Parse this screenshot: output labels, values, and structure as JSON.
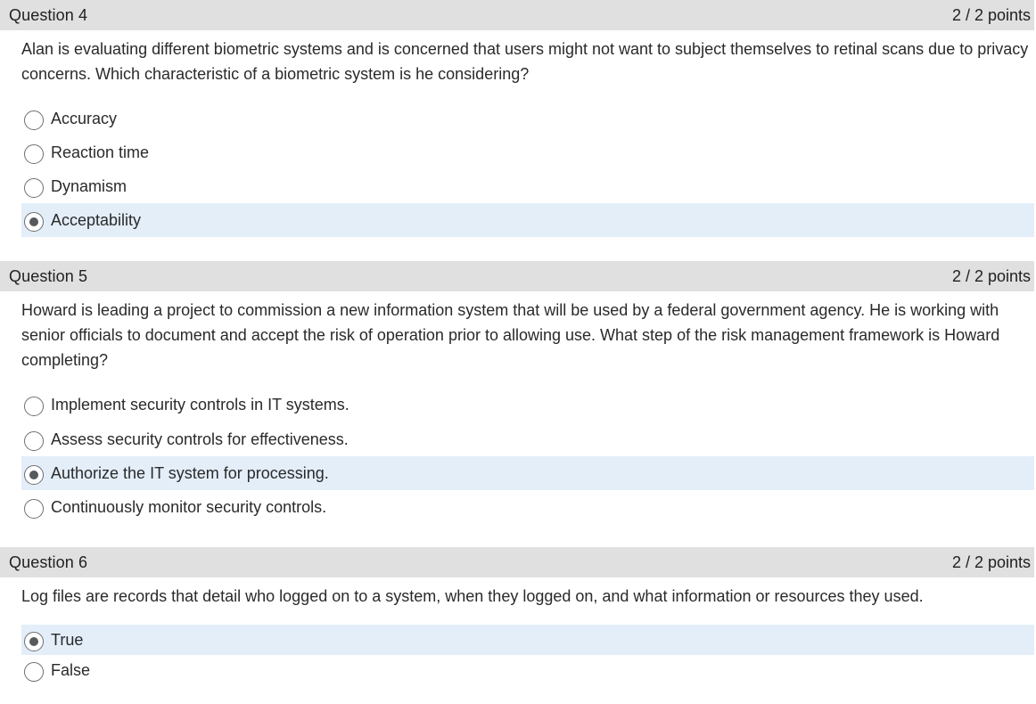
{
  "questions": [
    {
      "title": "Question 4",
      "points": "2 / 2 points",
      "text": "Alan is evaluating different biometric systems and is concerned that users might not want to subject themselves to retinal scans due to privacy concerns. Which characteristic of a biometric system is he considering?",
      "options": [
        {
          "label": "Accuracy",
          "selected": false
        },
        {
          "label": "Reaction time",
          "selected": false
        },
        {
          "label": "Dynamism",
          "selected": false
        },
        {
          "label": "Acceptability",
          "selected": true
        }
      ]
    },
    {
      "title": "Question 5",
      "points": "2 / 2 points",
      "text": "Howard is leading a project to commission a new information system that will be used by a federal government agency. He is working with senior officials to document and accept the risk of operation prior to allowing use. What step of the risk management framework is Howard completing?",
      "options": [
        {
          "label": "Implement security controls in IT systems.",
          "selected": false
        },
        {
          "label": "Assess security controls for effectiveness.",
          "selected": false
        },
        {
          "label": "Authorize the IT system for processing.",
          "selected": true
        },
        {
          "label": "Continuously monitor security controls.",
          "selected": false
        }
      ]
    },
    {
      "title": "Question 6",
      "points": "2 / 2 points",
      "text": "Log files are records that detail who logged on to a system, when they logged on, and what information or resources they used.",
      "options": [
        {
          "label": "True",
          "selected": true
        },
        {
          "label": "False",
          "selected": false
        }
      ]
    }
  ]
}
